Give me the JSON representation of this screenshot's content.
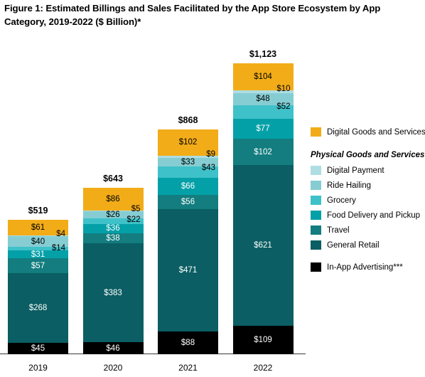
{
  "title": "Figure 1: Estimated Billings and Sales Facilitated by the App Store Ecosystem by App Category, 2019-2022 ($ Billion)*",
  "legend": {
    "digital_goods": {
      "label": "Digital Goods and Services**",
      "color": "#F2AC18"
    },
    "physical_header": "Physical Goods and Services",
    "physical_items": [
      {
        "label": "Digital Payment",
        "color": "#AEDDE3"
      },
      {
        "label": "Ride Hailing",
        "color": "#86CDD3"
      },
      {
        "label": "Grocery",
        "color": "#3FC1C9"
      },
      {
        "label": "Food Delivery and Pickup",
        "color": "#04A0A8"
      },
      {
        "label": "Travel",
        "color": "#137D7F"
      },
      {
        "label": "General Retail",
        "color": "#0B5E63"
      }
    ],
    "advertising": {
      "label": "In-App Advertising***",
      "color": "#000000"
    }
  },
  "chart_data": {
    "type": "bar",
    "subtype": "stacked",
    "title": "Figure 1: Estimated Billings and Sales Facilitated by the App Store Ecosystem by App Category, 2019-2022 ($ Billion)*",
    "xlabel": "",
    "ylabel": "",
    "categories": [
      "2019",
      "2020",
      "2021",
      "2022"
    ],
    "totals": [
      519,
      643,
      868,
      1123
    ],
    "total_labels": [
      "$519",
      "$643",
      "$868",
      "$1,123"
    ],
    "grid": false,
    "legend_position": "right",
    "series": [
      {
        "name": "Digital Goods and Services**",
        "color": "#F2AC18",
        "values": [
          61,
          86,
          102,
          104
        ],
        "labels": [
          "$61",
          "$86",
          "$102",
          "$104"
        ],
        "label_style": "dark"
      },
      {
        "name": "Digital Payment",
        "color": "#AEDDE3",
        "values": [
          4,
          5,
          9,
          10
        ],
        "labels": [
          "$4",
          "$5",
          "$9",
          "$10"
        ],
        "label_style": "dark-callout"
      },
      {
        "name": "Ride Hailing",
        "color": "#86CDD3",
        "values": [
          40,
          26,
          33,
          48
        ],
        "labels": [
          "$40",
          "$26",
          "$33",
          "$48"
        ],
        "label_style": "dark"
      },
      {
        "name": "Grocery",
        "color": "#3FC1C9",
        "values": [
          14,
          22,
          43,
          52
        ],
        "labels": [
          "$14",
          "$22",
          "$43",
          "$52"
        ],
        "label_style": "dark-callout-small"
      },
      {
        "name": "Food Delivery and Pickup",
        "color": "#04A0A8",
        "values": [
          31,
          36,
          66,
          77
        ],
        "labels": [
          "$31",
          "$36",
          "$66",
          "$77"
        ],
        "label_style": "light"
      },
      {
        "name": "Travel",
        "color": "#137D7F",
        "values": [
          57,
          38,
          56,
          102
        ],
        "labels": [
          "$57",
          "$38",
          "$56",
          "$102"
        ],
        "label_style": "light"
      },
      {
        "name": "General Retail",
        "color": "#0B5E63",
        "values": [
          268,
          383,
          471,
          621
        ],
        "labels": [
          "$268",
          "$383",
          "$471",
          "$621"
        ],
        "label_style": "light"
      },
      {
        "name": "In-App Advertising***",
        "color": "#000000",
        "values": [
          45,
          46,
          88,
          109
        ],
        "labels": [
          "$45",
          "$46",
          "$88",
          "$109"
        ],
        "label_style": "light"
      }
    ]
  }
}
